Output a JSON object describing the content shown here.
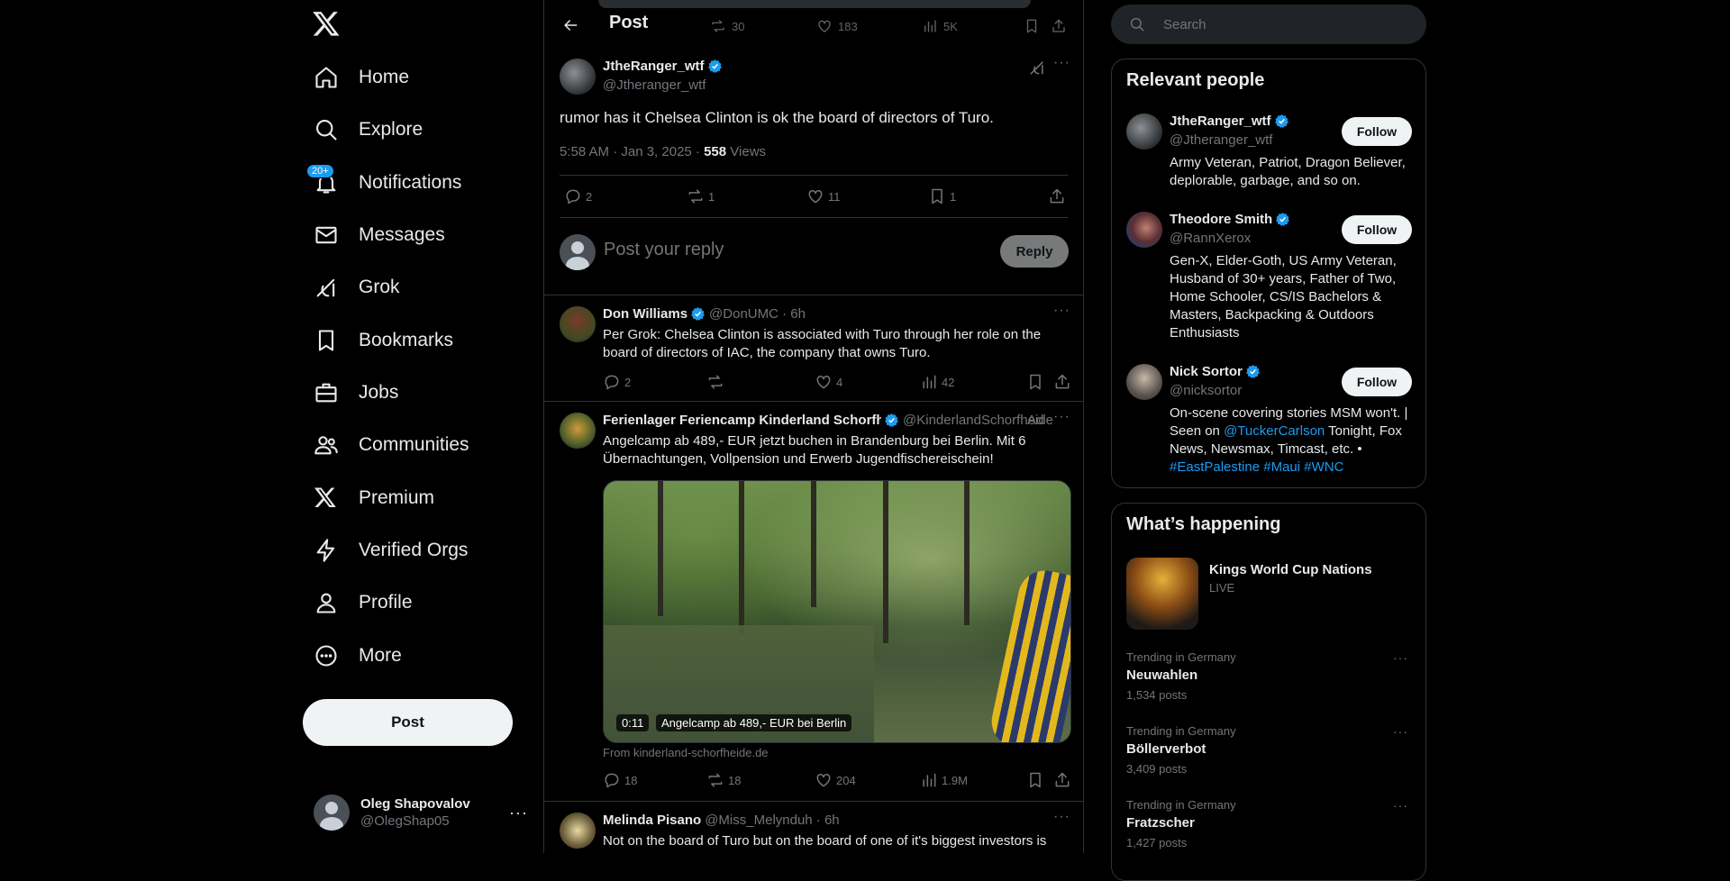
{
  "nav": {
    "items": [
      {
        "label": "Home",
        "icon": "home-icon"
      },
      {
        "label": "Explore",
        "icon": "search-icon"
      },
      {
        "label": "Notifications",
        "icon": "bell-icon",
        "badge": "20+"
      },
      {
        "label": "Messages",
        "icon": "envelope-icon"
      },
      {
        "label": "Grok",
        "icon": "grok-icon"
      },
      {
        "label": "Bookmarks",
        "icon": "bookmark-icon"
      },
      {
        "label": "Jobs",
        "icon": "briefcase-icon"
      },
      {
        "label": "Communities",
        "icon": "people-icon"
      },
      {
        "label": "Premium",
        "icon": "x-logo-icon"
      },
      {
        "label": "Verified Orgs",
        "icon": "lightning-icon"
      },
      {
        "label": "Profile",
        "icon": "person-icon"
      },
      {
        "label": "More",
        "icon": "more-circle-icon"
      }
    ],
    "post_label": "Post"
  },
  "account": {
    "name": "Oleg Shapovalov",
    "handle": "@OlegShap05"
  },
  "header": {
    "title": "Post",
    "prev_actions": {
      "reposts": "30",
      "likes": "183",
      "views": "5K"
    }
  },
  "tweet": {
    "name": "JtheRanger_wtf",
    "handle": "@Jtheranger_wtf",
    "text": "rumor has it Chelsea Clinton is ok the board of directors of Turo.",
    "datetime": "5:58 AM · Jan 3, 2025 · ",
    "views_count": "558",
    "views_label": " Views",
    "replies": "2",
    "reposts": "1",
    "likes": "11",
    "bookmarks": "1"
  },
  "composer": {
    "placeholder": "Post your reply",
    "reply_label": "Reply"
  },
  "replies": [
    {
      "name": "Don Williams",
      "handle": "@DonUMC · 6h",
      "text": "Per Grok: Chelsea Clinton is associated with Turo through her role on the board of directors of IAC, the company that owns Turo.",
      "replies": "2",
      "reposts": "",
      "likes": "4",
      "views": "42"
    },
    {
      "name": "Ferienlager Feriencamp Kinderland Schorfheide",
      "handle": "@KinderlandSchorfheide",
      "ad_label": "Ad",
      "text": "Angelcamp ab 489,- EUR jetzt buchen in Brandenburg bei Berlin. Mit 6 Übernachtungen, Vollpension und Erwerb Jugendfischereischein!",
      "video_time": "0:11",
      "video_caption": "Angelcamp ab 489,- EUR bei Berlin",
      "source": "From kinderland-schorfheide.de",
      "replies": "18",
      "reposts": "18",
      "likes": "204",
      "views": "1.9M"
    },
    {
      "name": "Melinda Pisano",
      "handle": "@Miss_Melynduh · 6h",
      "text": "Not on the board of Turo but on the board of one of it's biggest investors is"
    }
  ],
  "search": {
    "placeholder": "Search"
  },
  "relevant": {
    "title": "Relevant people",
    "people": [
      {
        "name": "JtheRanger_wtf",
        "handle": "@Jtheranger_wtf",
        "bio": "Army Veteran, Patriot, Dragon Believer, deplorable, garbage, and so on.",
        "follow": "Follow"
      },
      {
        "name": "Theodore Smith",
        "handle": "@RannXerox",
        "bio": "Gen-X, Elder-Goth, US Army Veteran, Husband of 30+ years, Father of Two, Home Schooler, CS/IS Bachelors & Masters, Backpacking & Outdoors Enthusiasts",
        "follow": "Follow"
      },
      {
        "name": "Nick Sortor",
        "handle": "@nicksortor",
        "bio_before": "On-scene covering stories MSM won't. | Seen on ",
        "bio_link": "@TuckerCarlson",
        "bio_after": " Tonight, Fox News, Newsmax, Timcast, etc. • ",
        "bio_tags": "#EastPalestine #Maui #WNC",
        "follow": "Follow"
      }
    ]
  },
  "happening": {
    "title": "What’s happening",
    "live": {
      "title": "Kings World Cup Nations",
      "tag": "LIVE"
    },
    "trends": [
      {
        "category": "Trending in Germany",
        "name": "Neuwahlen",
        "count": "1,534 posts"
      },
      {
        "category": "Trending in Germany",
        "name": "Böllerverbot",
        "count": "3,409 posts"
      },
      {
        "category": "Trending in Germany",
        "name": "Fratzscher",
        "count": "1,427 posts"
      }
    ]
  },
  "colors": {
    "accent": "#1d9bf0",
    "background": "#000000",
    "border": "#2f3336",
    "muted": "#71767b"
  }
}
